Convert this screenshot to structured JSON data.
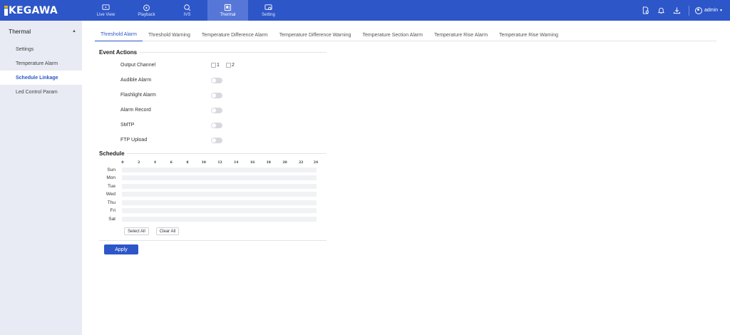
{
  "brand": {
    "logo_text": "KEGAWA",
    "accent": "#2d56c8",
    "logo_mark_color": "#f2b01e"
  },
  "nav": [
    {
      "label": "Live View",
      "icon": "monitor-icon",
      "active": false
    },
    {
      "label": "Playback",
      "icon": "playback-icon",
      "active": false
    },
    {
      "label": "IVS",
      "icon": "ivs-icon",
      "active": false
    },
    {
      "label": "Thermal",
      "icon": "thermal-icon",
      "active": true
    },
    {
      "label": "Setting",
      "icon": "setting-icon",
      "active": false
    }
  ],
  "topbar": {
    "icons": [
      "file-icon",
      "bell-icon",
      "download-icon"
    ],
    "user": "admin"
  },
  "sidebar": {
    "title": "Thermal",
    "items": [
      {
        "label": "Settings",
        "active": false
      },
      {
        "label": "Temperature Alarm",
        "active": false
      },
      {
        "label": "Schedule Linkage",
        "active": true
      },
      {
        "label": "Led Control Param",
        "active": false
      }
    ]
  },
  "tabs": [
    {
      "label": "Threshold Alarm",
      "active": true
    },
    {
      "label": "Threshold Warning",
      "active": false
    },
    {
      "label": "Temperature Difference Alarm",
      "active": false
    },
    {
      "label": "Temperature Difference Warning",
      "active": false
    },
    {
      "label": "Temperature Section Alarm",
      "active": false
    },
    {
      "label": "Temperature Rise Alarm",
      "active": false
    },
    {
      "label": "Temperature Rise Warning",
      "active": false
    }
  ],
  "event_actions": {
    "title": "Event Actions",
    "output_channel": {
      "label": "Output Channel",
      "options": [
        "1",
        "2"
      ],
      "checked": [
        false,
        false
      ]
    },
    "toggles": [
      {
        "label": "Audible Alarm",
        "on": false
      },
      {
        "label": "Flashlight Alarm",
        "on": false
      },
      {
        "label": "Alarm Record",
        "on": false
      },
      {
        "label": "SMTP",
        "on": false
      },
      {
        "label": "FTP Upload",
        "on": false
      }
    ]
  },
  "schedule": {
    "title": "Schedule",
    "hours": [
      "0",
      "2",
      "4",
      "6",
      "8",
      "10",
      "12",
      "14",
      "16",
      "18",
      "20",
      "22",
      "24"
    ],
    "days": [
      "Sun",
      "Mon",
      "Tue",
      "Wed",
      "Thu",
      "Fri",
      "Sat"
    ],
    "select_all": "Select All",
    "clear_all": "Clear All"
  },
  "apply_label": "Apply"
}
